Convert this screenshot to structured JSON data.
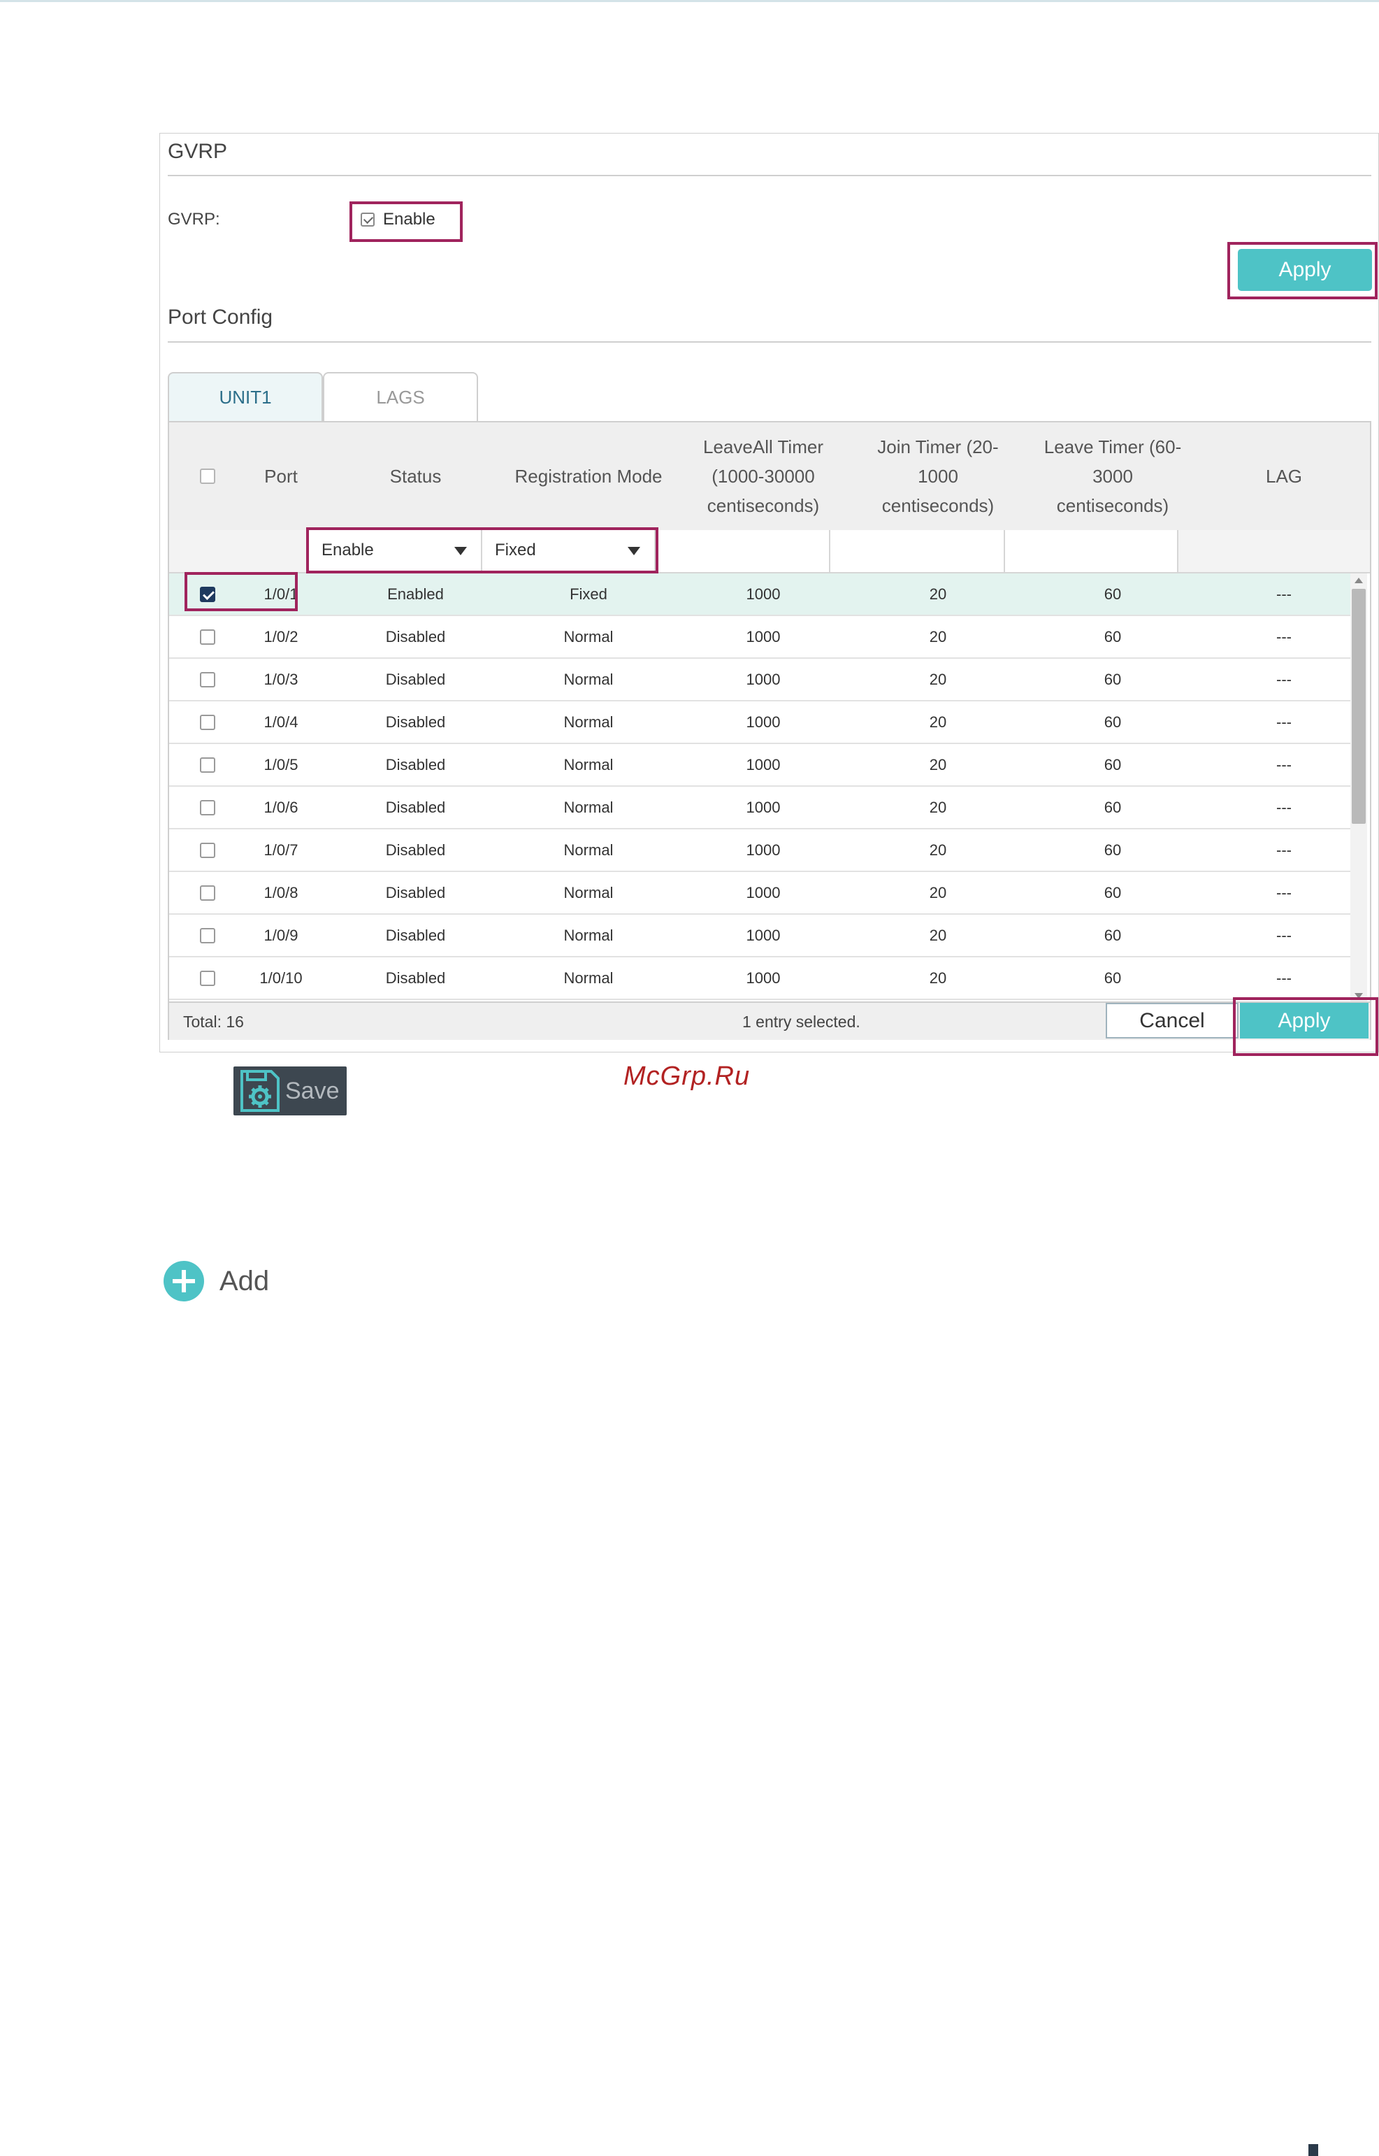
{
  "gvrp": {
    "title": "GVRP",
    "label": "GVRP:",
    "enable_label": "Enable",
    "enabled": true,
    "apply_label": "Apply"
  },
  "port_config": {
    "title": "Port Config",
    "tabs": [
      {
        "label": "UNIT1",
        "active": true
      },
      {
        "label": "LAGS",
        "active": false
      }
    ],
    "columns": [
      "Port",
      "Status",
      "Registration Mode",
      "LeaveAll Timer\n(1000-30000\ncentiseconds)",
      "Join Timer (20-\n1000\ncentiseconds)",
      "Leave Timer (60-\n3000\ncentiseconds)",
      "LAG"
    ],
    "filter": {
      "status_value": "Enable",
      "registration_mode_value": "Fixed",
      "leaveall_value": "",
      "join_value": "",
      "leave_value": ""
    },
    "rows": [
      {
        "checked": true,
        "port": "1/0/1",
        "status": "Enabled",
        "mode": "Fixed",
        "leaveall": "1000",
        "join": "20",
        "leave": "60",
        "lag": "---"
      },
      {
        "checked": false,
        "port": "1/0/2",
        "status": "Disabled",
        "mode": "Normal",
        "leaveall": "1000",
        "join": "20",
        "leave": "60",
        "lag": "---"
      },
      {
        "checked": false,
        "port": "1/0/3",
        "status": "Disabled",
        "mode": "Normal",
        "leaveall": "1000",
        "join": "20",
        "leave": "60",
        "lag": "---"
      },
      {
        "checked": false,
        "port": "1/0/4",
        "status": "Disabled",
        "mode": "Normal",
        "leaveall": "1000",
        "join": "20",
        "leave": "60",
        "lag": "---"
      },
      {
        "checked": false,
        "port": "1/0/5",
        "status": "Disabled",
        "mode": "Normal",
        "leaveall": "1000",
        "join": "20",
        "leave": "60",
        "lag": "---"
      },
      {
        "checked": false,
        "port": "1/0/6",
        "status": "Disabled",
        "mode": "Normal",
        "leaveall": "1000",
        "join": "20",
        "leave": "60",
        "lag": "---"
      },
      {
        "checked": false,
        "port": "1/0/7",
        "status": "Disabled",
        "mode": "Normal",
        "leaveall": "1000",
        "join": "20",
        "leave": "60",
        "lag": "---"
      },
      {
        "checked": false,
        "port": "1/0/8",
        "status": "Disabled",
        "mode": "Normal",
        "leaveall": "1000",
        "join": "20",
        "leave": "60",
        "lag": "---"
      },
      {
        "checked": false,
        "port": "1/0/9",
        "status": "Disabled",
        "mode": "Normal",
        "leaveall": "1000",
        "join": "20",
        "leave": "60",
        "lag": "---"
      },
      {
        "checked": false,
        "port": "1/0/10",
        "status": "Disabled",
        "mode": "Normal",
        "leaveall": "1000",
        "join": "20",
        "leave": "60",
        "lag": "---"
      }
    ],
    "footer": {
      "total": "Total: 16",
      "selection": "1 entry selected.",
      "cancel_label": "Cancel",
      "apply_label": "Apply"
    }
  },
  "save": {
    "label": "Save",
    "icon": "save-gear-icon"
  },
  "watermark": "McGrp.Ru",
  "add": {
    "label": "Add",
    "icon": "plus-circle-icon"
  },
  "colors": {
    "accent": "#4ec3c6",
    "highlight": "#a0245d",
    "selected_row": "#e3f3ef"
  }
}
